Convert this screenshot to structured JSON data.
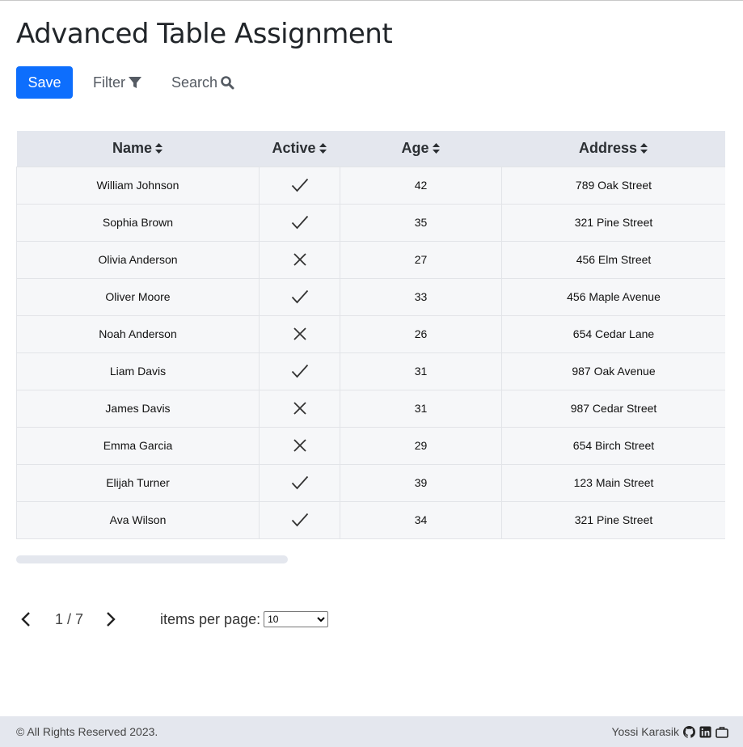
{
  "page": {
    "title": "Advanced Table Assignment"
  },
  "toolbar": {
    "save_label": "Save",
    "filter_label": "Filter",
    "search_label": "Search"
  },
  "table": {
    "columns": [
      "Name",
      "Active",
      "Age",
      "Address"
    ],
    "rows": [
      {
        "name": "William Johnson",
        "active": true,
        "age": "42",
        "address": "789 Oak Street"
      },
      {
        "name": "Sophia Brown",
        "active": true,
        "age": "35",
        "address": "321 Pine Street"
      },
      {
        "name": "Olivia Anderson",
        "active": false,
        "age": "27",
        "address": "456 Elm Street"
      },
      {
        "name": "Oliver Moore",
        "active": true,
        "age": "33",
        "address": "456 Maple Avenue"
      },
      {
        "name": "Noah Anderson",
        "active": false,
        "age": "26",
        "address": "654 Cedar Lane"
      },
      {
        "name": "Liam Davis",
        "active": true,
        "age": "31",
        "address": "987 Oak Avenue"
      },
      {
        "name": "James Davis",
        "active": false,
        "age": "31",
        "address": "987 Cedar Street"
      },
      {
        "name": "Emma Garcia",
        "active": false,
        "age": "29",
        "address": "654 Birch Street"
      },
      {
        "name": "Elijah Turner",
        "active": true,
        "age": "39",
        "address": "123 Main Street"
      },
      {
        "name": "Ava Wilson",
        "active": true,
        "age": "34",
        "address": "321 Pine Street"
      }
    ]
  },
  "pagination": {
    "page_indicator": "1 / 7",
    "items_per_page_label": "items per page:",
    "items_per_page_value": "10"
  },
  "footer": {
    "copyright": "© All Rights Reserved 2023.",
    "author": "Yossi Karasik"
  },
  "colors": {
    "primary": "#0d6efd",
    "header_bg": "#e4e7ee",
    "row_bg": "#f6f7f9"
  }
}
